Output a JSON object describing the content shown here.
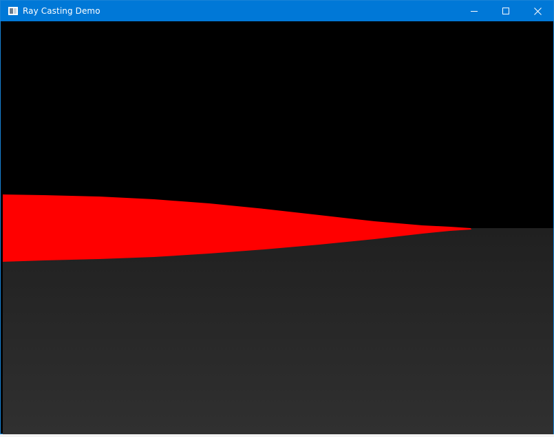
{
  "window": {
    "title": "Ray Casting Demo",
    "controls": {
      "minimize": "minimize-icon",
      "maximize": "maximize-icon",
      "close": "close-icon"
    }
  },
  "scene": {
    "ceiling_color": "#000000",
    "floor_color_top": "#202020",
    "floor_color_bottom": "#303030",
    "wall_color": "#ff0000"
  },
  "colors": {
    "titlebar": "#0078d7",
    "titlebar_text": "#ffffff"
  }
}
